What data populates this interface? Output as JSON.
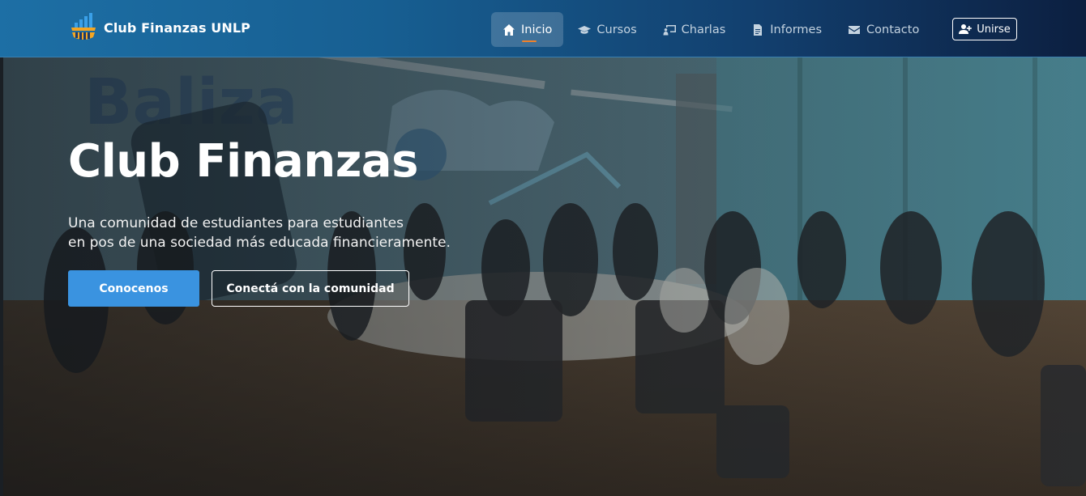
{
  "brand": {
    "name": "Club Finanzas UNLP",
    "logo_icon": "bar-chart-logo-icon"
  },
  "nav": {
    "items": [
      {
        "label": "Inicio",
        "icon": "home-icon",
        "active": true
      },
      {
        "label": "Cursos",
        "icon": "graduation-cap-icon",
        "active": false
      },
      {
        "label": "Charlas",
        "icon": "presentation-icon",
        "active": false
      },
      {
        "label": "Informes",
        "icon": "document-icon",
        "active": false
      },
      {
        "label": "Contacto",
        "icon": "envelope-icon",
        "active": false
      }
    ],
    "join_label": "Unirse",
    "join_icon": "user-plus-icon"
  },
  "hero": {
    "title": "Club Finanzas",
    "subtitle_line1": "Una comunidad de estudiantes para estudiantes",
    "subtitle_line2": "en pos de una sociedad más educada financieramente.",
    "primary_button": "Conocenos",
    "secondary_button": "Conectá con la comunidad"
  },
  "colors": {
    "navbar_start": "#1d6fa5",
    "navbar_end": "#0c1f40",
    "primary_button": "#3a93e0",
    "active_underline": "#f0812a"
  }
}
